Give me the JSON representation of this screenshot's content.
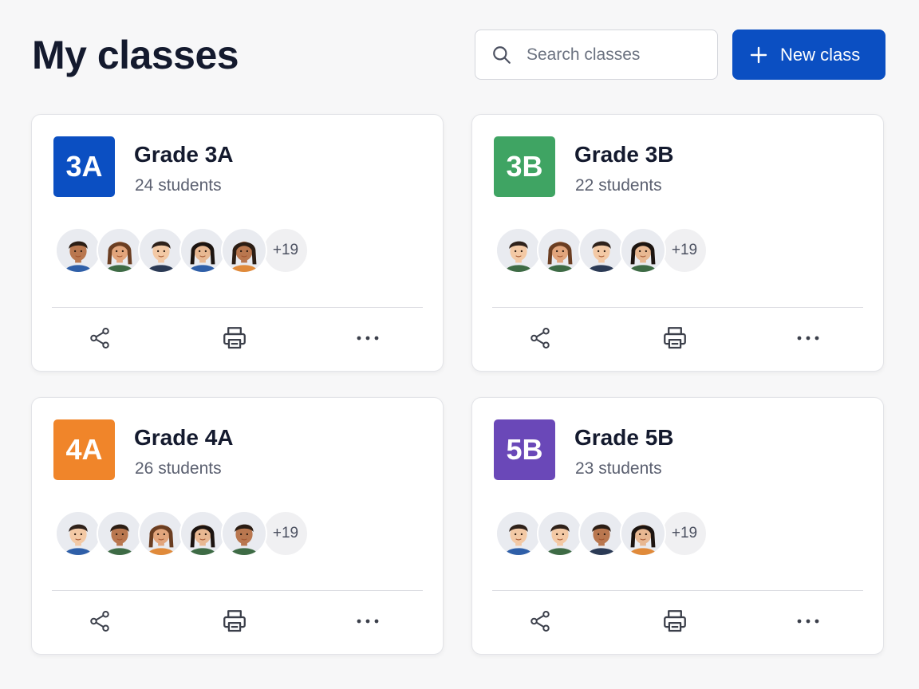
{
  "page": {
    "title": "My classes",
    "search_placeholder": "Search classes",
    "new_class_label": "New class"
  },
  "colors": {
    "primary": "#0b4fc2",
    "badge_3A": "#0b4fc2",
    "badge_3B": "#3fa463",
    "badge_4A": "#f0852a",
    "badge_5B": "#6a48b8"
  },
  "classes": [
    {
      "badge": "3A",
      "badge_color": "#0b4fc2",
      "name": "Grade 3A",
      "students": "24 students",
      "avatars": [
        "boy-dark-blue",
        "girl-brown-green",
        "boy-light-navy",
        "girl-black-blue",
        "girl-dark-orange"
      ],
      "more": "+19"
    },
    {
      "badge": "3B",
      "badge_color": "#3fa463",
      "name": "Grade 3B",
      "students": "22 students",
      "avatars": [
        "boy-light-green",
        "girl-brown-green",
        "boy-light-navy",
        "girl-black-green"
      ],
      "more": "+19"
    },
    {
      "badge": "4A",
      "badge_color": "#f0852a",
      "name": "Grade 4A",
      "students": "26 students",
      "avatars": [
        "boy-light-blue",
        "boy-dark-green",
        "girl-brown-orange",
        "girl-black-green",
        "boy-dark-green"
      ],
      "more": "+19"
    },
    {
      "badge": "5B",
      "badge_color": "#6a48b8",
      "name": "Grade 5B",
      "students": "23 students",
      "avatars": [
        "boy-light-blue",
        "boy-light-green",
        "boy-dark-navy",
        "girl-black-orange"
      ],
      "more": "+19"
    }
  ],
  "actions": [
    "share-icon",
    "printer-icon",
    "more-horizontal-icon"
  ]
}
